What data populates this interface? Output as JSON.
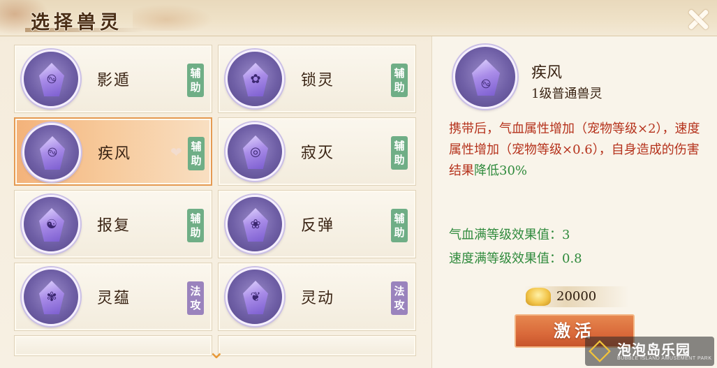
{
  "header": {
    "title": "选择兽灵"
  },
  "list": {
    "items": [
      {
        "name": "影遁",
        "tag": "辅助",
        "tag_type": "assist",
        "icon": "spirit-gem-icon",
        "glyph": "࿊"
      },
      {
        "name": "锁灵",
        "tag": "辅助",
        "tag_type": "assist",
        "icon": "spirit-gem-icon",
        "glyph": "✿"
      },
      {
        "name": "疾风",
        "tag": "辅助",
        "tag_type": "assist",
        "icon": "spirit-gem-icon",
        "glyph": "࿊",
        "selected": true,
        "heart": "❤"
      },
      {
        "name": "寂灭",
        "tag": "辅助",
        "tag_type": "assist",
        "icon": "spirit-gem-icon",
        "glyph": "◎"
      },
      {
        "name": "报复",
        "tag": "辅助",
        "tag_type": "assist",
        "icon": "spirit-gem-icon",
        "glyph": "☯"
      },
      {
        "name": "反弹",
        "tag": "辅助",
        "tag_type": "assist",
        "icon": "spirit-gem-icon",
        "glyph": "❀"
      },
      {
        "name": "灵蕴",
        "tag": "法攻",
        "tag_type": "magic",
        "icon": "spirit-gem-icon",
        "glyph": "✾"
      },
      {
        "name": "灵动",
        "tag": "法攻",
        "tag_type": "magic",
        "icon": "spirit-gem-icon",
        "glyph": "❦"
      }
    ],
    "scroll_arrow": "⌄"
  },
  "detail": {
    "name": "疾风",
    "level": "1级普通兽灵",
    "desc_part1": "携带后，气血属性增加（宠物等级×2），速度属性增加（宠物等级×0.6），自身造成的伤害结果",
    "desc_part2": "降低30%",
    "stat1": "气血满等级效果值：3",
    "stat2": "速度满等级效果值：0.8",
    "cost": "20000",
    "activate_label": "激活",
    "glyph": "࿊"
  },
  "watermark": {
    "text": "泡泡岛乐园",
    "sub": "BUBBLE ISLAND AMUSEMENT PARK"
  },
  "colors": {
    "assist_tag": "#6fae86",
    "magic_tag": "#9a83bd",
    "desc_red": "#b5321c",
    "desc_green": "#2f8a3c",
    "selected_card": "#f3b27a",
    "activate_button": "#d9693a"
  }
}
